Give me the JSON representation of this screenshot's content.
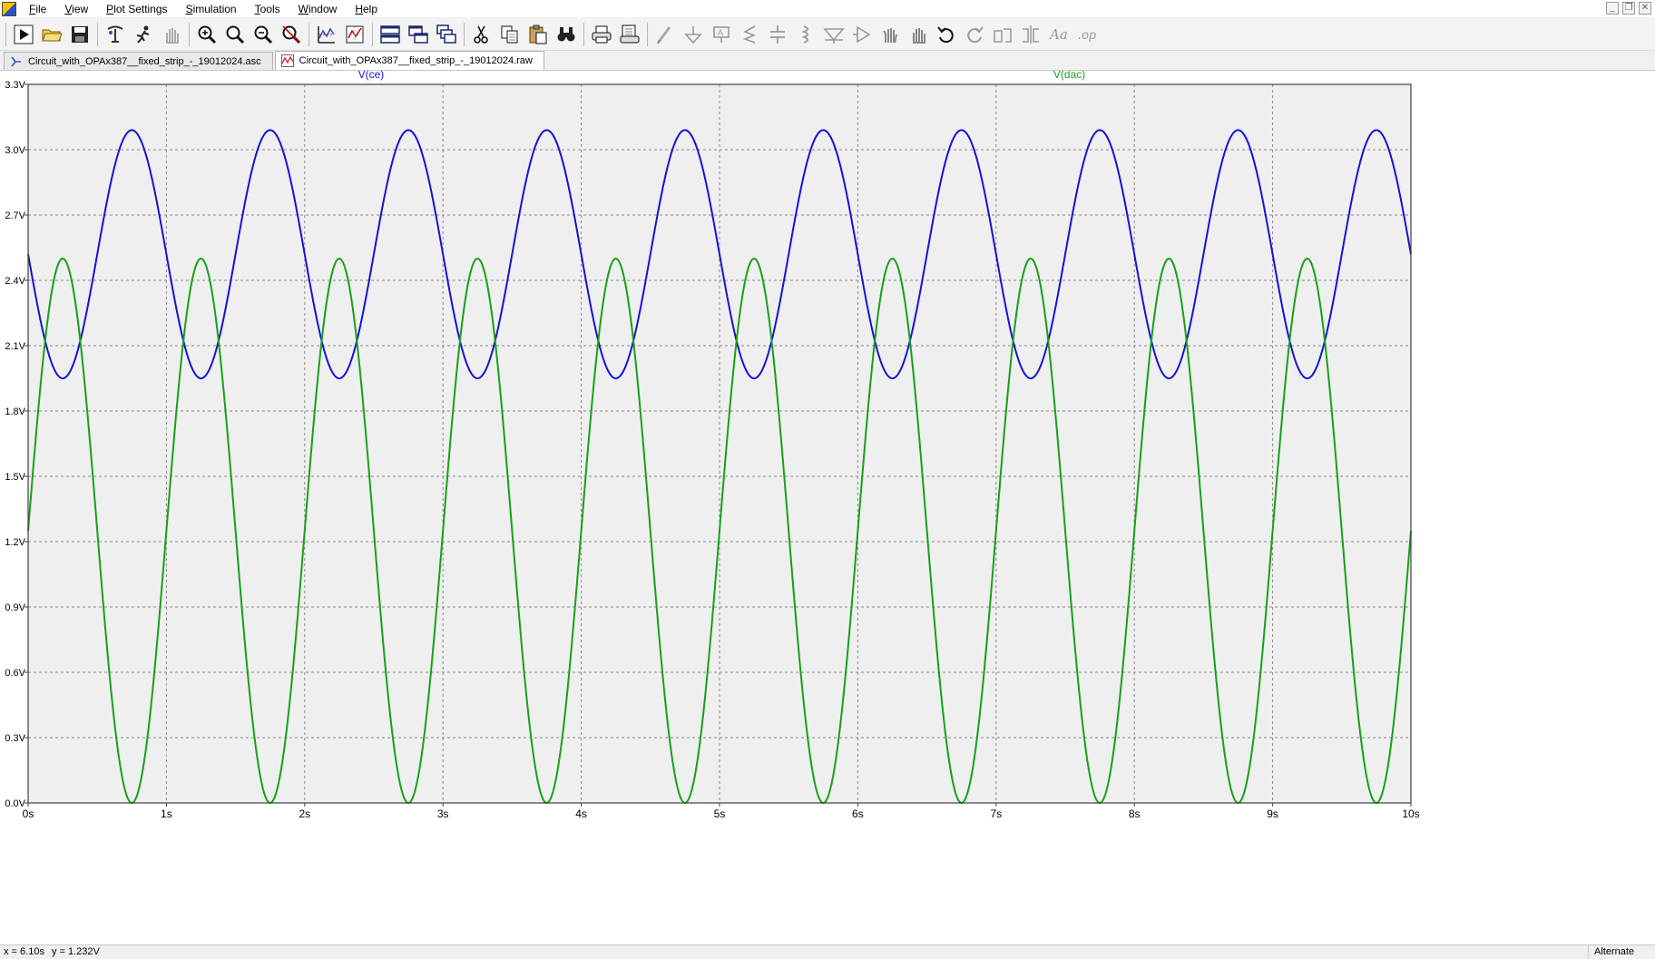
{
  "menu": [
    "File",
    "View",
    "Plot Settings",
    "Simulation",
    "Tools",
    "Window",
    "Help"
  ],
  "window_controls": [
    "minimize",
    "restore",
    "close"
  ],
  "toolbar": {
    "groups": [
      [
        "run-icon",
        "open-folder-icon",
        "save-icon"
      ],
      [
        "control-panel-icon",
        "run-halt-icon",
        "pan-hand-icon"
      ],
      [
        "zoom-in-icon",
        "zoom-full-icon",
        "zoom-out-icon",
        "zoom-cancel-icon"
      ],
      [
        "autorange-icon",
        "pick-visible-traces-icon"
      ],
      [
        "tile-horizontal-icon",
        "tile-vertical-icon",
        "cascade-icon"
      ],
      [
        "cut-icon",
        "copy-icon",
        "paste-icon",
        "find-icon"
      ],
      [
        "print-icon",
        "print-preview-icon"
      ],
      [
        "draw-wire-icon",
        "ground-icon",
        "label-net-icon",
        "resistor-icon",
        "capacitor-icon",
        "inductor-icon",
        "diode-icon",
        "component-icon",
        "move-icon",
        "drag-icon",
        "undo-icon",
        "redo-icon",
        "rotate-icon",
        "mirror-icon",
        "text-icon",
        "spice-directive-icon"
      ]
    ]
  },
  "tabs": [
    {
      "label": "Circuit_with_OPAx387__fixed_strip_-_19012024.asc",
      "icon": "schematic-icon",
      "active": false
    },
    {
      "label": "Circuit_with_OPAx387__fixed_strip_-_19012024.raw",
      "icon": "waveform-icon",
      "active": true
    }
  ],
  "colors": {
    "plot_bg": "#efefef",
    "grid": "#8a8a8a",
    "trace_ce": "#1414d2",
    "trace_dac": "#18a018",
    "axis_text": "#000000"
  },
  "chart_data": {
    "type": "line",
    "x_unit": "s",
    "y_unit": "V",
    "xlim": [
      0,
      10
    ],
    "ylim": [
      0,
      3.3
    ],
    "x_ticks": [
      "0s",
      "1s",
      "2s",
      "3s",
      "4s",
      "5s",
      "6s",
      "7s",
      "8s",
      "9s",
      "10s"
    ],
    "y_ticks": [
      "0.0V",
      "0.3V",
      "0.6V",
      "0.9V",
      "1.2V",
      "1.5V",
      "1.8V",
      "2.1V",
      "2.4V",
      "2.7V",
      "3.0V",
      "3.3V"
    ],
    "grid": true,
    "series": [
      {
        "name": "V(ce)",
        "color": "#1414d2",
        "waveform": "sine",
        "offset": 2.52,
        "amplitude": 0.57,
        "period": 1.0,
        "phase_deg": 180
      },
      {
        "name": "V(dac)",
        "color": "#18a018",
        "waveform": "sine",
        "offset": 1.25,
        "amplitude": 1.25,
        "period": 1.0,
        "phase_deg": 0
      }
    ]
  },
  "status": {
    "x_readout": "x = 6.10s",
    "y_readout": "y = 1.232V",
    "mode": "Alternate"
  }
}
